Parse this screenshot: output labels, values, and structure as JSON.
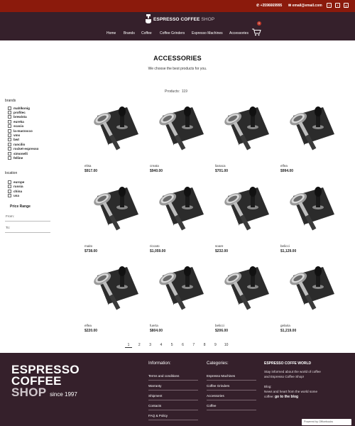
{
  "topbar": {
    "phone": "+3596669995",
    "email": "email@email.com",
    "social": [
      "f",
      "t",
      "g"
    ]
  },
  "brand": {
    "name_main": "ESPRESSO COFFEE",
    "name_shop": "SHOP"
  },
  "nav": {
    "items": [
      "Home",
      "Brands",
      "Coffee",
      "Coffee Grinders",
      "Espresso Machines",
      "Accessories"
    ]
  },
  "cart": {
    "count": "0"
  },
  "page": {
    "title": "ACCESSORIES",
    "subtitle": "We choose the best products for you.",
    "count_label": "Products:",
    "count_value": "119"
  },
  "filters": {
    "brands_label": "brands",
    "brands": [
      "mahlkonig",
      "profitec",
      "brewista",
      "eureka",
      "scacia",
      "la-marzocco",
      "vms",
      "bwt",
      "rancilio",
      "rocket-espresso",
      "simonelli",
      "felline"
    ],
    "location_label": "location",
    "locations": [
      "europe",
      "russia",
      "china",
      "usa"
    ],
    "price_range_label": "Price Range",
    "from_label": "From:",
    "to_label": "To:"
  },
  "products": [
    {
      "name": "elisa",
      "price": "$917.00"
    },
    {
      "name": "creata",
      "price": "$940.00"
    },
    {
      "name": "lianaca",
      "price": "$701.00"
    },
    {
      "name": "elfea",
      "price": "$994.00"
    },
    {
      "name": "maito",
      "price": "$738.00"
    },
    {
      "name": "riccato",
      "price": "$1,059.00"
    },
    {
      "name": "soare",
      "price": "$232.00"
    },
    {
      "name": "belicci",
      "price": "$1,129.00"
    },
    {
      "name": "elfea",
      "price": "$220.00"
    },
    {
      "name": "fuerta",
      "price": "$804.00"
    },
    {
      "name": "belicci",
      "price": "$206.00"
    },
    {
      "name": "gelaria",
      "price": "$1,219.00"
    }
  ],
  "pagination": {
    "pages": [
      "1",
      "2",
      "3",
      "4",
      "5",
      "6",
      "7",
      "8",
      "9",
      "10"
    ],
    "active": "1"
  },
  "footer": {
    "logo_line1": "ESPRESSO",
    "logo_line2": "COFFEE",
    "logo_line3": "SHOP",
    "logo_since": "since 1997",
    "info_head": "Information:",
    "info_links": [
      "Terms and conditions",
      "Warranty",
      "Shipment",
      "Contacts",
      "FAQ & Policy"
    ],
    "cat_head": "Categories:",
    "cat_links": [
      "Espresso Machines",
      "Coffee Grinders",
      "Accessories",
      "Coffee"
    ],
    "world_head_main": "ESPRESSO COFFE",
    "world_head_bold": "WORLD",
    "world_text1": "Stay informed about the world of coffee",
    "world_text2": "and Espresso Coffee Shop!",
    "blog_label": "Blog:",
    "blog_text1": "News and heart from the world some",
    "blog_text2": "coffee:",
    "blog_link": "go to the blog",
    "powered": "Powered by Officebooks"
  },
  "colors": {
    "topbar": "#8b1a0c",
    "header": "#35202b",
    "footer": "#35202b",
    "badge": "#c0392b"
  }
}
